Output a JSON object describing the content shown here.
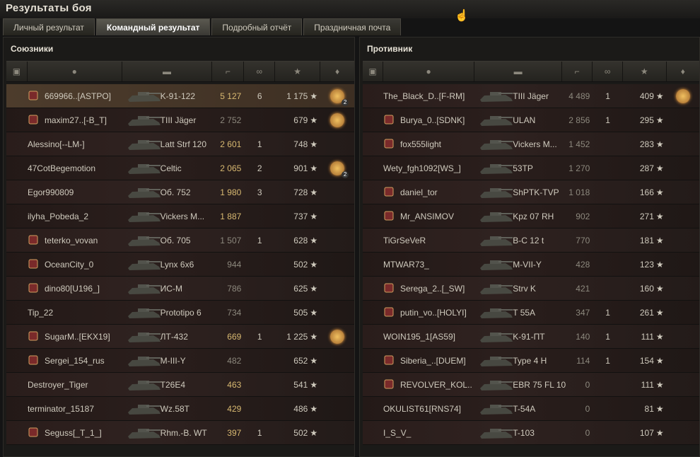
{
  "window": {
    "title": "Результаты боя"
  },
  "tabs": [
    {
      "label": "Личный результат"
    },
    {
      "label": "Командный результат"
    },
    {
      "label": "Подробный отчёт"
    },
    {
      "label": "Праздничная почта"
    }
  ],
  "active_tab": 1,
  "allies": {
    "title": "Союзники",
    "rows": [
      {
        "badge": "clan",
        "name": "669966..[ASTPO]",
        "tank": "K-91-122",
        "dmg": "5 127",
        "kills": "6",
        "xp": "1 175",
        "medal": "2",
        "me": true,
        "dmg_hi": true
      },
      {
        "badge": "clan",
        "name": "maxim27..[-B_T]",
        "tank": "TIII Jäger",
        "dmg": "2 752",
        "kills": "",
        "xp": "679",
        "medal": "1",
        "dmg_hi": false
      },
      {
        "badge": "",
        "name": "Alessino[--LM-]",
        "tank": "Latt Strf 120",
        "dmg": "2 601",
        "kills": "1",
        "xp": "748",
        "medal": "",
        "dmg_hi": true
      },
      {
        "badge": "",
        "name": "47CotBegemotion",
        "tank": "Celtic",
        "dmg": "2 065",
        "kills": "2",
        "xp": "901",
        "medal": "2",
        "dmg_hi": true
      },
      {
        "badge": "",
        "name": "Egor990809",
        "tank": "Об. 752",
        "dmg": "1 980",
        "kills": "3",
        "xp": "728",
        "medal": "",
        "dmg_hi": true
      },
      {
        "badge": "",
        "name": "ilyha_Pobeda_2",
        "tank": "Vickers M...",
        "dmg": "1 887",
        "kills": "",
        "xp": "737",
        "medal": "",
        "dmg_hi": true
      },
      {
        "badge": "clan",
        "name": "teterko_vovan",
        "tank": "Об. 705",
        "dmg": "1 507",
        "kills": "1",
        "xp": "628",
        "medal": "",
        "dmg_hi": false
      },
      {
        "badge": "clan",
        "name": "OceanCity_0",
        "tank": "Lynx 6x6",
        "dmg": "944",
        "kills": "",
        "xp": "502",
        "medal": "",
        "dmg_hi": false
      },
      {
        "badge": "clan",
        "name": "dino80[U196_]",
        "tank": "ИС-М",
        "dmg": "786",
        "kills": "",
        "xp": "625",
        "medal": "",
        "dmg_hi": false
      },
      {
        "badge": "",
        "name": "Tip_22",
        "tank": "Prototipo 6",
        "dmg": "734",
        "kills": "",
        "xp": "505",
        "medal": "",
        "dmg_hi": false
      },
      {
        "badge": "clan",
        "name": "SugarM..[EKX19]",
        "tank": "ЛТ-432",
        "dmg": "669",
        "kills": "1",
        "xp": "1 225",
        "medal": "1",
        "dmg_hi": true
      },
      {
        "badge": "clan",
        "name": "Sergei_154_rus",
        "tank": "M-III-Y",
        "dmg": "482",
        "kills": "",
        "xp": "652",
        "medal": "",
        "dmg_hi": false
      },
      {
        "badge": "",
        "name": "Destroyer_Tiger",
        "tank": "T26E4",
        "dmg": "463",
        "kills": "",
        "xp": "541",
        "medal": "",
        "dmg_hi": true
      },
      {
        "badge": "",
        "name": "terminator_15187",
        "tank": "Wz.58T",
        "dmg": "429",
        "kills": "",
        "xp": "486",
        "medal": "",
        "dmg_hi": true
      },
      {
        "badge": "clan",
        "name": "Seguss[_T_1_]",
        "tank": "Rhm.-B. WT",
        "dmg": "397",
        "kills": "1",
        "xp": "502",
        "medal": "",
        "dmg_hi": true
      }
    ]
  },
  "enemies": {
    "title": "Противник",
    "rows": [
      {
        "badge": "",
        "name": "The_Black_D..[F-RM]",
        "tank": "TIII Jäger",
        "dmg": "4 489",
        "kills": "1",
        "xp": "409",
        "medal": "1"
      },
      {
        "badge": "clan",
        "name": "Burya_0..[SDNK]",
        "tank": "ULAN",
        "dmg": "2 856",
        "kills": "1",
        "xp": "295",
        "medal": ""
      },
      {
        "badge": "clan",
        "name": "fox555light",
        "tank": "Vickers M...",
        "dmg": "1 452",
        "kills": "",
        "xp": "283",
        "medal": ""
      },
      {
        "badge": "",
        "name": "Wety_fgh1092[WS_]",
        "tank": "53TP",
        "dmg": "1 270",
        "kills": "",
        "xp": "287",
        "medal": ""
      },
      {
        "badge": "clan",
        "name": "daniel_tor",
        "tank": "ShPTK-TVP",
        "dmg": "1 018",
        "kills": "",
        "xp": "166",
        "medal": ""
      },
      {
        "badge": "clan",
        "name": "Mr_ANSIMOV",
        "tank": "Kpz 07 RH",
        "dmg": "902",
        "kills": "",
        "xp": "271",
        "medal": ""
      },
      {
        "badge": "",
        "name": "TiGrSeVeR",
        "tank": "B-C 12 t",
        "dmg": "770",
        "kills": "",
        "xp": "181",
        "medal": ""
      },
      {
        "badge": "",
        "name": "MTWAR73_",
        "tank": "M-VII-Y",
        "dmg": "428",
        "kills": "",
        "xp": "123",
        "medal": ""
      },
      {
        "badge": "clan",
        "name": "Serega_2..[_SW]",
        "tank": "Strv K",
        "dmg": "421",
        "kills": "",
        "xp": "160",
        "medal": ""
      },
      {
        "badge": "clan",
        "name": "putin_vo..[HOLYI]",
        "tank": "T 55A",
        "dmg": "347",
        "kills": "1",
        "xp": "261",
        "medal": ""
      },
      {
        "badge": "",
        "name": "WOIN195_1[AS59]",
        "tank": "K-91-ПТ",
        "dmg": "140",
        "kills": "1",
        "xp": "111",
        "medal": ""
      },
      {
        "badge": "clan",
        "name": "Siberia_..[DUEM]",
        "tank": "Type 4 H",
        "dmg": "114",
        "kills": "1",
        "xp": "154",
        "medal": ""
      },
      {
        "badge": "clan",
        "name": "REVOLVER_KOL..",
        "tank": "EBR 75 FL 10",
        "dmg": "0",
        "kills": "",
        "xp": "111",
        "medal": ""
      },
      {
        "badge": "",
        "name": "OKULIST61[RNS74]",
        "tank": "T-54A",
        "dmg": "0",
        "kills": "",
        "xp": "81",
        "medal": ""
      },
      {
        "badge": "",
        "name": "I_S_V_",
        "tank": "T-103",
        "dmg": "0",
        "kills": "",
        "xp": "107",
        "medal": ""
      }
    ]
  }
}
